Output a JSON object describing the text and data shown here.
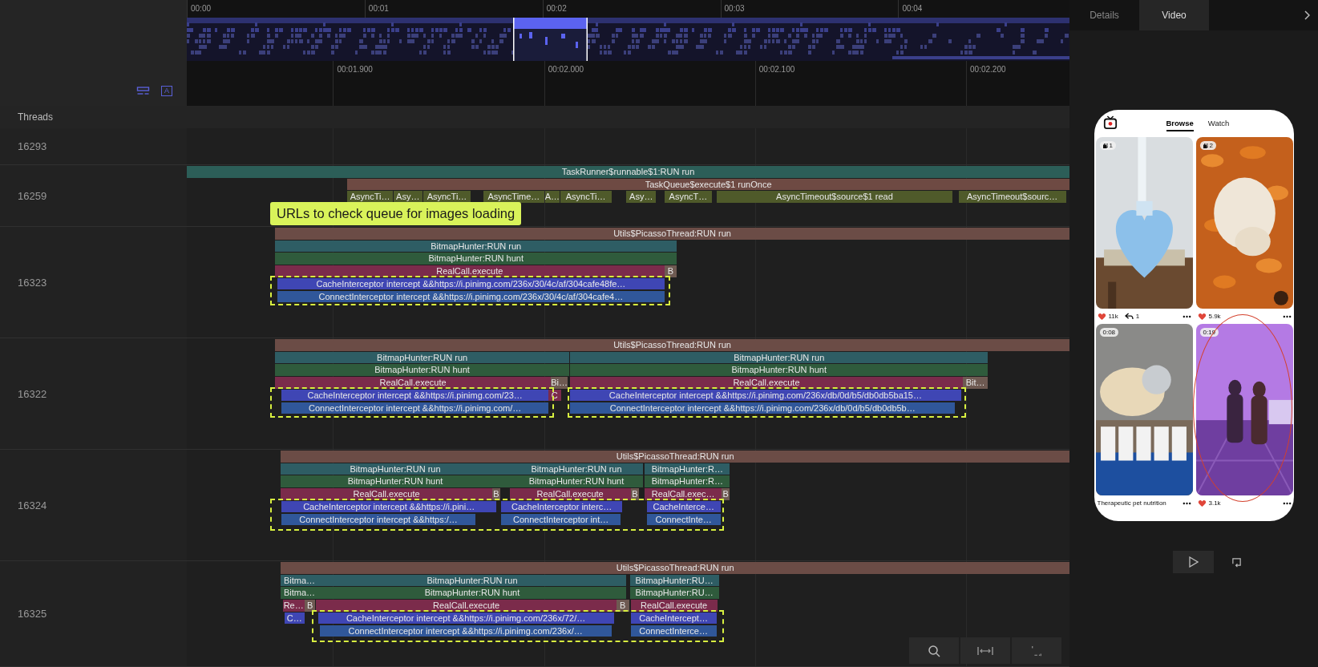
{
  "timeline": {
    "overview_ticks": [
      "00:00",
      "00:01",
      "00:02",
      "00:03",
      "00:04"
    ],
    "detail_ticks": [
      "00:01.900",
      "00:02.000",
      "00:02.100",
      "00:02.200"
    ],
    "text_toggle": "A"
  },
  "threads_label": "Threads",
  "threads": [
    {
      "id": "16293"
    },
    {
      "id": "16259",
      "note": "URLs to check queue for images loading",
      "levels": [
        [
          {
            "label": "TaskRunner$runnable$1:RUN run",
            "color": "#2c5e58"
          }
        ],
        [
          {
            "label": "TaskQueue$execute$1 runOnce",
            "color": "#6e4a43"
          }
        ],
        [
          {
            "label": "AsyncTi…",
            "color": "#4f5a2a"
          },
          {
            "label": "Asy…",
            "color": "#4f5a2a"
          },
          {
            "label": "AsyncTi…",
            "color": "#4f5a2a"
          },
          {
            "label": "AsyncTime…",
            "color": "#4f5a2a"
          },
          {
            "label": "A…",
            "color": "#4f5a2a"
          },
          {
            "label": "AsyncTi…",
            "color": "#4f5a2a"
          },
          {
            "label": "Asy…",
            "color": "#4f5a2a"
          },
          {
            "label": "AsyncT…",
            "color": "#4f5a2a"
          },
          {
            "label": "AsyncTimeout$source$1 read",
            "color": "#4f5a2a"
          },
          {
            "label": "AsyncTimeout$sourc…",
            "color": "#4f5a2a"
          }
        ]
      ]
    },
    {
      "id": "16323",
      "levels": [
        [
          {
            "label": "Utils$PicassoThread:RUN run",
            "color": "#6b4c46"
          }
        ],
        [
          {
            "label": "BitmapHunter:RUN run",
            "color": "#2e5d64"
          }
        ],
        [
          {
            "label": "BitmapHunter:RUN hunt",
            "color": "#2f5b3c"
          }
        ],
        [
          {
            "label": "RealCall.execute",
            "color": "#7b2b4b"
          },
          {
            "label": "B",
            "color": "#6e5a52"
          }
        ],
        [
          {
            "label": "CacheInterceptor intercept &&https://i.pinimg.com/236x/30/4c/af/304cafe48fe…",
            "color": "#3f46b4"
          }
        ],
        [
          {
            "label": "ConnectInterceptor intercept &&https://i.pinimg.com/236x/30/4c/af/304cafe4…",
            "color": "#30579a"
          }
        ]
      ]
    },
    {
      "id": "16322",
      "levels": [
        [
          {
            "label": "Utils$PicassoThread:RUN run",
            "color": "#6b4c46"
          }
        ],
        [
          {
            "label": "BitmapHunter:RUN run",
            "color": "#2e5d64"
          },
          {
            "label": "BitmapHunter:RUN run",
            "color": "#2e5d64"
          }
        ],
        [
          {
            "label": "BitmapHunter:RUN hunt",
            "color": "#2f5b3c"
          },
          {
            "label": "BitmapHunter:RUN hunt",
            "color": "#2f5b3c"
          }
        ],
        [
          {
            "label": "RealCall.execute",
            "color": "#7b2b4b"
          },
          {
            "label": "Bi…",
            "color": "#6e5a52"
          },
          {
            "label": "RealCall.execute",
            "color": "#7b2b4b"
          },
          {
            "label": "Bit…",
            "color": "#6e5a52"
          }
        ],
        [
          {
            "label": "CacheInterceptor intercept &&https://i.pinimg.com/23…",
            "color": "#3f46b4"
          },
          {
            "label": "C",
            "color": "#7b2b4b"
          },
          {
            "label": "CacheInterceptor intercept &&https://i.pinimg.com/236x/db/0d/b5/db0db5ba15…",
            "color": "#3f46b4"
          }
        ],
        [
          {
            "label": "ConnectInterceptor intercept &&https://i.pinimg.com/…",
            "color": "#30579a"
          },
          {
            "label": "ConnectInterceptor intercept &&https://i.pinimg.com/236x/db/0d/b5/db0db5b…",
            "color": "#30579a"
          }
        ]
      ]
    },
    {
      "id": "16324",
      "levels": [
        [
          {
            "label": "Utils$PicassoThread:RUN run",
            "color": "#6b4c46"
          }
        ],
        [
          {
            "label": "BitmapHunter:RUN run",
            "color": "#2e5d64"
          },
          {
            "label": "BitmapHunter:RUN run",
            "color": "#2e5d64"
          },
          {
            "label": "BitmapHunter:R…",
            "color": "#2e5d64"
          }
        ],
        [
          {
            "label": "BitmapHunter:RUN hunt",
            "color": "#2f5b3c"
          },
          {
            "label": "BitmapHunter:RUN hunt",
            "color": "#2f5b3c"
          },
          {
            "label": "BitmapHunter:R…",
            "color": "#2f5b3c"
          }
        ],
        [
          {
            "label": "RealCall.execute",
            "color": "#7b2b4b"
          },
          {
            "label": "B",
            "color": "#6e5a52"
          },
          {
            "label": "RealCall.execute",
            "color": "#7b2b4b"
          },
          {
            "label": "B",
            "color": "#6e5a52"
          },
          {
            "label": "RealCall.exec…",
            "color": "#7b2b4b"
          },
          {
            "label": "B",
            "color": "#6e5a52"
          }
        ],
        [
          {
            "label": "CacheInterceptor intercept &&https://i.pini…",
            "color": "#3f46b4"
          },
          {
            "label": "CacheInterceptor interc…",
            "color": "#3f46b4"
          },
          {
            "label": "CacheInterce…",
            "color": "#3f46b4"
          }
        ],
        [
          {
            "label": "ConnectInterceptor intercept &&https:/…",
            "color": "#30579a"
          },
          {
            "label": "ConnectInterceptor int…",
            "color": "#30579a"
          },
          {
            "label": "ConnectInte…",
            "color": "#30579a"
          }
        ]
      ]
    },
    {
      "id": "16325",
      "levels": [
        [
          {
            "label": "Utils$PicassoThread:RUN run",
            "color": "#6b4c46"
          }
        ],
        [
          {
            "label": "Bitma…",
            "color": "#2e5d64"
          },
          {
            "label": "BitmapHunter:RUN run",
            "color": "#2e5d64"
          },
          {
            "label": "BitmapHunter:RU…",
            "color": "#2e5d64"
          }
        ],
        [
          {
            "label": "Bitma…",
            "color": "#2f5b3c"
          },
          {
            "label": "BitmapHunter:RUN hunt",
            "color": "#2f5b3c"
          },
          {
            "label": "BitmapHunter:RU…",
            "color": "#2f5b3c"
          }
        ],
        [
          {
            "label": "Re…",
            "color": "#7b2b4b"
          },
          {
            "label": "B",
            "color": "#6e5a52"
          },
          {
            "label": "RealCall.execute",
            "color": "#7b2b4b"
          },
          {
            "label": "B",
            "color": "#6e5a52"
          },
          {
            "label": "RealCall.execute",
            "color": "#7b2b4b"
          }
        ],
        [
          {
            "label": "C…",
            "color": "#3f46b4"
          },
          {
            "label": "CacheInterceptor intercept &&https://i.pinimg.com/236x/72/…",
            "color": "#3f46b4"
          },
          {
            "label": "CacheIntercept…",
            "color": "#3f46b4"
          }
        ],
        [
          {
            "label": "ConnectInterceptor intercept &&https://i.pinimg.com/236x/…",
            "color": "#30579a"
          },
          {
            "label": "ConnectInterce…",
            "color": "#30579a"
          }
        ]
      ]
    }
  ],
  "side_panel": {
    "tabs": [
      {
        "label": "Details",
        "selected": false
      },
      {
        "label": "Video",
        "selected": true
      }
    ],
    "phone": {
      "tabs": [
        {
          "label": "Browse",
          "selected": true
        },
        {
          "label": "Watch",
          "selected": false
        }
      ],
      "cards": [
        {
          "badge": "1",
          "kind": "count",
          "likes": "11k",
          "shares": "1"
        },
        {
          "badge": "2",
          "kind": "count",
          "likes": "5.9k"
        },
        {
          "badge": "0:08",
          "kind": "duration",
          "caption": "Therapeutic pet nutrition"
        },
        {
          "badge": "0:19",
          "kind": "duration",
          "likes": "3.1k",
          "circled": true
        }
      ]
    }
  }
}
